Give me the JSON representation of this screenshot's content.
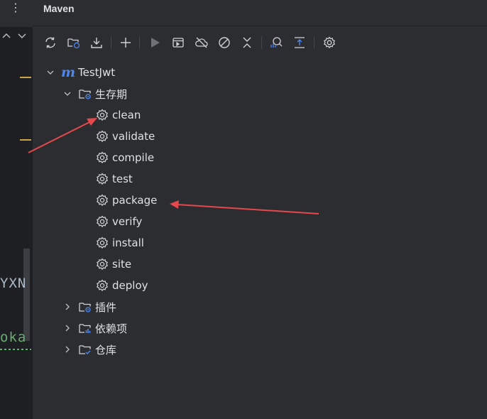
{
  "window": {
    "more_menu_glyph": "⋮"
  },
  "editor": {
    "line1_text": "YXN",
    "line2_text": "oka"
  },
  "panel": {
    "title": "Maven"
  },
  "toolbar": {
    "items": [
      {
        "icon": "reload-icon"
      },
      {
        "icon": "generate-sources-icon"
      },
      {
        "icon": "download-icon"
      },
      {
        "icon": "add-icon"
      },
      {
        "icon": "run-icon"
      },
      {
        "icon": "run-configuration-icon"
      },
      {
        "icon": "offline-icon"
      },
      {
        "icon": "skip-tests-icon"
      },
      {
        "icon": "collapse-icon"
      },
      {
        "icon": "analyze-dependencies-icon"
      },
      {
        "icon": "show-diagram-icon"
      },
      {
        "icon": "settings-icon"
      }
    ]
  },
  "tree": {
    "project": {
      "label": "TestJwt",
      "logo": "m"
    },
    "lifecycle": {
      "label": "生存期",
      "phases": [
        "clean",
        "validate",
        "compile",
        "test",
        "package",
        "verify",
        "install",
        "site",
        "deploy"
      ]
    },
    "plugins": {
      "label": "插件"
    },
    "dependencies": {
      "label": "依赖项"
    },
    "repositories": {
      "label": "仓库"
    }
  },
  "colors": {
    "accent": "#4f87f0",
    "arrow": "#e5484d",
    "background": "#2b2d30"
  }
}
